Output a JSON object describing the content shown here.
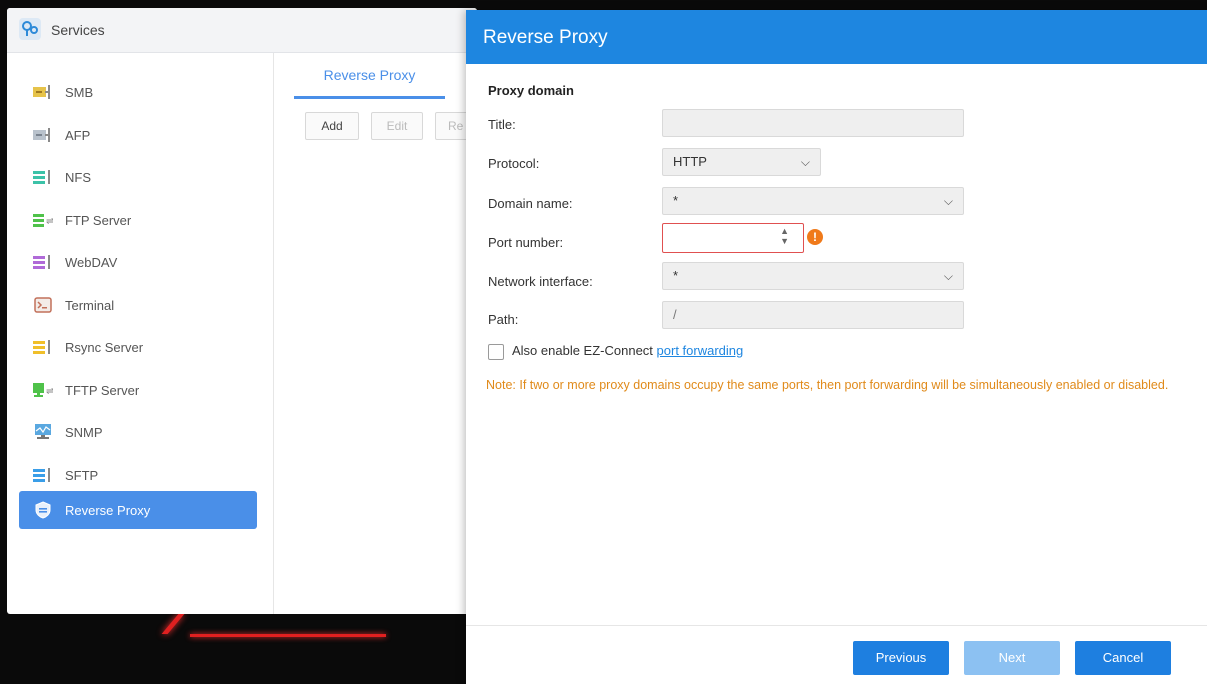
{
  "services_window": {
    "title": "Services",
    "sidebar": [
      {
        "label": "SMB",
        "icon": "smb-icon",
        "active": false
      },
      {
        "label": "AFP",
        "icon": "afp-icon",
        "active": false
      },
      {
        "label": "NFS",
        "icon": "nfs-icon",
        "active": false
      },
      {
        "label": "FTP Server",
        "icon": "ftp-icon",
        "active": false
      },
      {
        "label": "WebDAV",
        "icon": "webdav-icon",
        "active": false
      },
      {
        "label": "Terminal",
        "icon": "terminal-icon",
        "active": false
      },
      {
        "label": "Rsync Server",
        "icon": "rsync-icon",
        "active": false
      },
      {
        "label": "TFTP Server",
        "icon": "tftp-icon",
        "active": false
      },
      {
        "label": "SNMP",
        "icon": "snmp-icon",
        "active": false
      },
      {
        "label": "SFTP",
        "icon": "sftp-icon",
        "active": false
      },
      {
        "label": "Reverse Proxy",
        "icon": "shield-icon",
        "active": true
      }
    ],
    "tab": "Reverse Proxy",
    "buttons": {
      "add": "Add",
      "edit": "Edit",
      "remove": "Re"
    }
  },
  "dialog": {
    "title": "Reverse Proxy",
    "section_title": "Proxy domain",
    "fields": {
      "title_label": "Title:",
      "title_value": "",
      "protocol_label": "Protocol:",
      "protocol_value": "HTTP",
      "domain_label": "Domain name:",
      "domain_value": "*",
      "port_label": "Port number:",
      "port_value": "",
      "network_label": "Network interface:",
      "network_value": "*",
      "path_label": "Path:",
      "path_value": "/"
    },
    "checkbox": {
      "label": "Also enable EZ-Connect ",
      "link": "port forwarding",
      "checked": false
    },
    "note": "Note: If two or more proxy domains occupy the same ports, then port forwarding will be simultaneously enabled or disabled.",
    "buttons": {
      "previous": "Previous",
      "next": "Next",
      "cancel": "Cancel"
    }
  },
  "colors": {
    "accent": "#1e86e0",
    "warning": "#f07a1a",
    "note": "#e08a1a",
    "error_border": "#e05050"
  }
}
